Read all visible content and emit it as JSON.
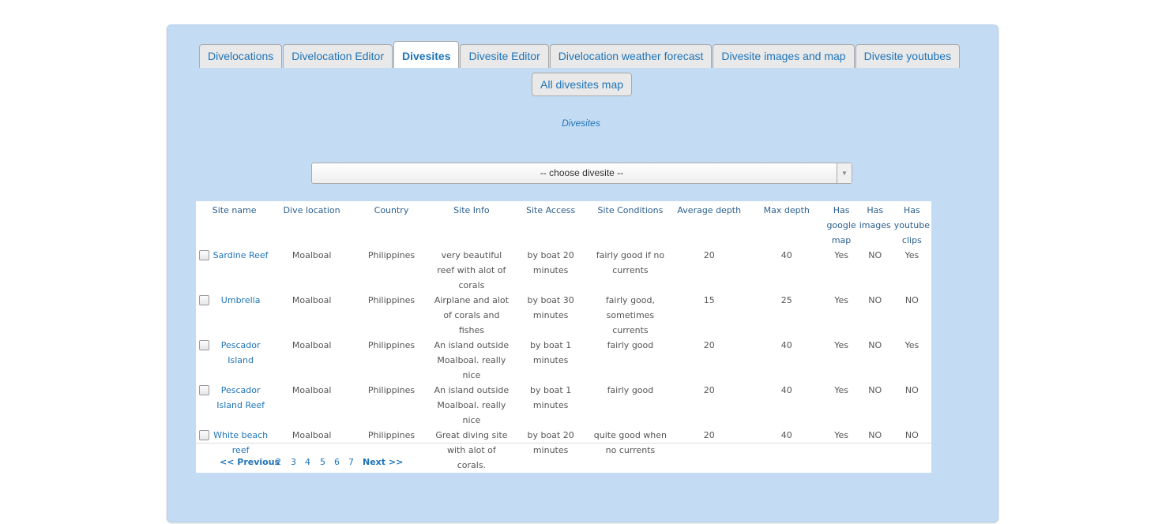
{
  "tabs": [
    "Divelocations",
    "Divelocation Editor",
    "Divesites",
    "Divesite Editor",
    "Divelocation weather forecast",
    "Divesite images and map",
    "Divesite youtubes"
  ],
  "tab_row2": "All divesites map",
  "section_title": "Divesites",
  "select": {
    "value": "-- choose divesite --"
  },
  "table": {
    "headers": [
      "Site name",
      "Dive location",
      "Country",
      "Site Info",
      "Site Access",
      "Site Conditions",
      "Average depth",
      "Max depth",
      "Has google map",
      "Has images",
      "Has youtube clips"
    ],
    "rows": [
      [
        "Sardine Reef",
        "Moalboal",
        "Philippines",
        "very beautiful reef with alot of corals",
        "by boat 20 minutes",
        "fairly good if no currents",
        "20",
        "40",
        "Yes",
        "NO",
        "Yes"
      ],
      [
        "Umbrella",
        "Moalboal",
        "Philippines",
        "Airplane and alot of corals and fishes",
        "by boat 30 minutes",
        "fairly good, sometimes currents",
        "15",
        "25",
        "Yes",
        "NO",
        "NO"
      ],
      [
        "Pescador Island",
        "Moalboal",
        "Philippines",
        "An island outside Moalboal. really nice",
        "by boat 1 minutes",
        "fairly good",
        "20",
        "40",
        "Yes",
        "NO",
        "Yes"
      ],
      [
        "Pescador Island Reef",
        "Moalboal",
        "Philippines",
        "An island outside Moalboal. really nice",
        "by boat 1 minutes",
        "fairly good",
        "20",
        "40",
        "Yes",
        "NO",
        "NO"
      ],
      [
        "White beach reef",
        "Moalboal",
        "Philippines",
        "Great diving site with alot of corals.",
        "by boat 20 minutes",
        "quite good when no currents",
        "20",
        "40",
        "Yes",
        "NO",
        "NO"
      ]
    ]
  },
  "pager": {
    "prev": "<< Previous",
    "pages": [
      "2",
      "3",
      "4",
      "5",
      "6",
      "7"
    ],
    "next": "Next >>"
  }
}
